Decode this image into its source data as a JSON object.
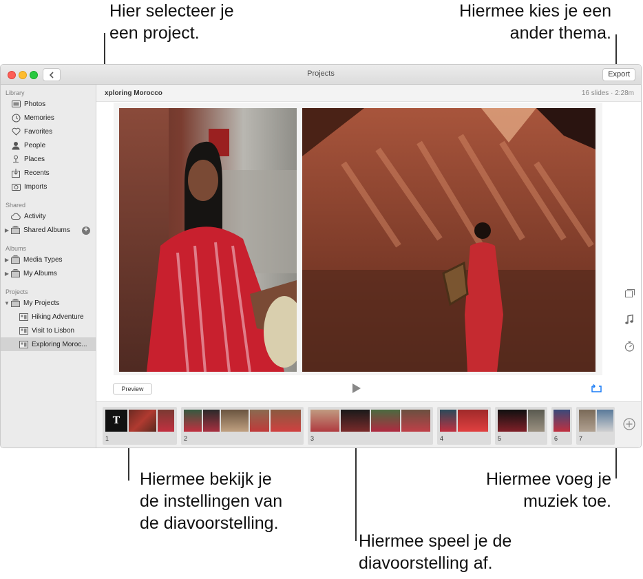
{
  "callouts": {
    "select_project": [
      "Hier selecteer je",
      "een project."
    ],
    "choose_theme": [
      "Hiermee kies je een",
      "ander thema."
    ],
    "preview_settings": [
      "Hiermee bekijk je",
      "de instellingen van",
      "de diavoorstelling."
    ],
    "add_music": [
      "Hiermee voeg je",
      "muziek toe."
    ],
    "play_slideshow": [
      "Hiermee speel je de",
      "diavoorstelling af."
    ]
  },
  "window": {
    "title": "Projects",
    "export_label": "Export"
  },
  "sidebar": {
    "sections": [
      {
        "label": "Library"
      },
      {
        "label": "Shared"
      },
      {
        "label": "Albums"
      },
      {
        "label": "Projects"
      }
    ],
    "library_items": [
      {
        "label": "Photos",
        "icon": "photos-icon"
      },
      {
        "label": "Memories",
        "icon": "memories-icon"
      },
      {
        "label": "Favorites",
        "icon": "heart-icon"
      },
      {
        "label": "People",
        "icon": "person-icon"
      },
      {
        "label": "Places",
        "icon": "pin-icon"
      },
      {
        "label": "Recents",
        "icon": "recents-icon"
      },
      {
        "label": "Imports",
        "icon": "imports-icon"
      }
    ],
    "shared_items": [
      {
        "label": "Activity",
        "icon": "cloud-icon"
      },
      {
        "label": "Shared Albums",
        "icon": "album-stack-icon"
      }
    ],
    "albums_items": [
      {
        "label": "Media Types",
        "icon": "album-stack-icon"
      },
      {
        "label": "My Albums",
        "icon": "album-stack-icon"
      }
    ],
    "projects_items": [
      {
        "label": "My Projects",
        "icon": "album-stack-icon"
      },
      {
        "label": "Hiking Adventure",
        "icon": "slideshow-icon"
      },
      {
        "label": "Visit to Lisbon",
        "icon": "slideshow-icon"
      },
      {
        "label": "Exploring Moroc...",
        "icon": "slideshow-icon",
        "selected": true
      }
    ]
  },
  "project": {
    "title": "xploring Morocco",
    "meta": "16 slides · 2:28m"
  },
  "controls": {
    "preview_label": "Preview"
  },
  "filmstrip": {
    "groups": [
      {
        "number": "1"
      },
      {
        "number": "2"
      },
      {
        "number": "3"
      },
      {
        "number": "4"
      },
      {
        "number": "5"
      },
      {
        "number": "6"
      },
      {
        "number": "7"
      }
    ],
    "title_slide_letter": "T"
  },
  "colors": {
    "accent": "#1a7cf5",
    "selected_row": "#d3d3d3",
    "sidebar_bg": "#ebebeb"
  }
}
